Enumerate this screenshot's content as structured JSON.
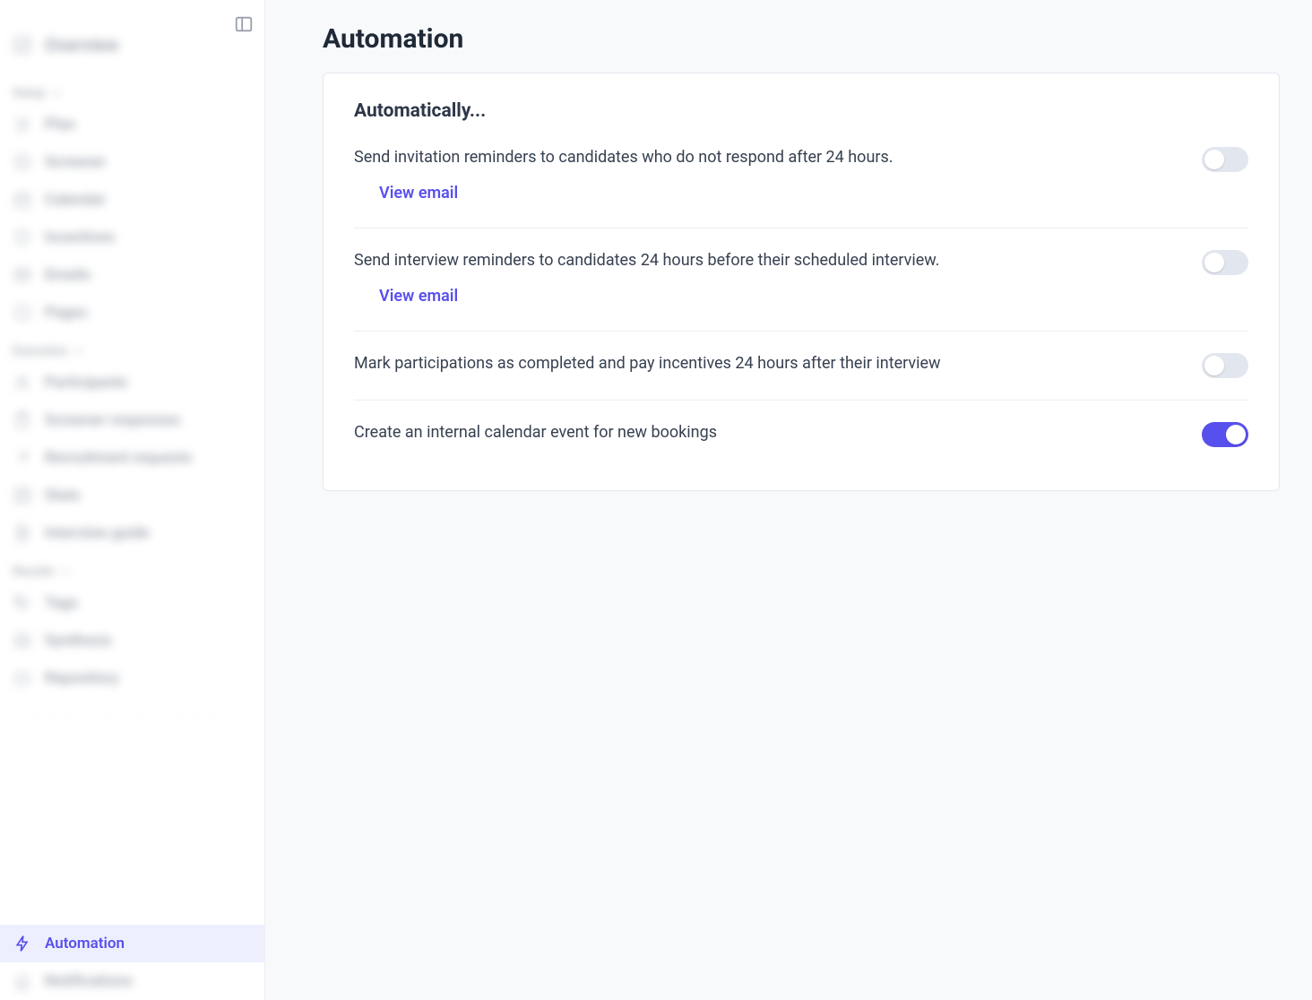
{
  "sidebar": {
    "overview_label": "Overview",
    "groups": [
      {
        "label": "Setup",
        "items": [
          {
            "key": "plan",
            "label": "Plan"
          },
          {
            "key": "screener",
            "label": "Screener"
          },
          {
            "key": "calendar",
            "label": "Calendar"
          },
          {
            "key": "incentives",
            "label": "Incentives"
          },
          {
            "key": "emails",
            "label": "Emails"
          },
          {
            "key": "pages",
            "label": "Pages"
          }
        ]
      },
      {
        "label": "Execution",
        "items": [
          {
            "key": "participants",
            "label": "Participants"
          },
          {
            "key": "screener-responses",
            "label": "Screener responses"
          },
          {
            "key": "recruitment-requests",
            "label": "Recruitment requests"
          },
          {
            "key": "stats",
            "label": "Stats"
          },
          {
            "key": "interview-guide",
            "label": "Interview guide"
          }
        ]
      },
      {
        "label": "Results",
        "items": [
          {
            "key": "tags",
            "label": "Tags"
          },
          {
            "key": "synthesis",
            "label": "Synthesis"
          },
          {
            "key": "repository",
            "label": "Repository"
          }
        ]
      }
    ],
    "bottom_items": [
      {
        "key": "automation",
        "label": "Automation",
        "active": true
      },
      {
        "key": "notifications",
        "label": "Notifications",
        "active": false
      }
    ]
  },
  "page": {
    "title": "Automation",
    "card_subtitle": "Automatically...",
    "link_label": "View email",
    "settings": [
      {
        "text": "Send invitation reminders to candidates who do not respond after 24 hours.",
        "has_link": true,
        "on": false
      },
      {
        "text": "Send interview reminders to candidates 24 hours before their scheduled interview.",
        "has_link": true,
        "on": false
      },
      {
        "text": "Mark participations as completed and pay incentives 24 hours after their interview",
        "has_link": false,
        "on": false
      },
      {
        "text": "Create an internal calendar event for new bookings",
        "has_link": false,
        "on": true
      }
    ]
  },
  "colors": {
    "accent": "#5850ec",
    "text": "#374151",
    "muted": "#6b7280"
  }
}
